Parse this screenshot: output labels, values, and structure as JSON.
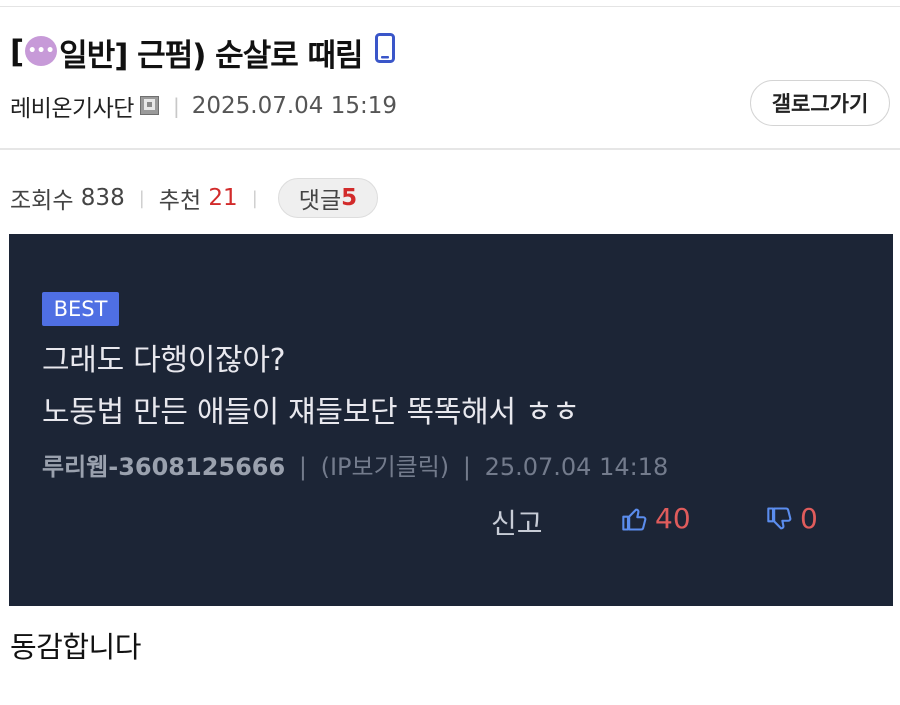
{
  "post": {
    "title_prefix": "[",
    "category": "일반",
    "title_rest": "] 근펌) 순살로 때림",
    "author": "레비온기사단",
    "date": "2025.07.04 15:19",
    "gallery_button": "갤로그가기",
    "stats": {
      "views_label": "조회수",
      "views": "838",
      "recommend_label": "추천",
      "recommend": "21",
      "comments_label": "댓글",
      "comments": "5"
    },
    "body": "동감합니다"
  },
  "embedded_comment": {
    "badge": "BEST",
    "line1": "그래도 다행이잖아?",
    "line2": "노동법 만든 애들이 쟤들보단 똑똑해서 ㅎㅎ",
    "nickname": "루리웹-3608125666",
    "ip": "(IP보기클릭)",
    "date": "25.07.04 14:18",
    "report": "신고",
    "upvotes": "40",
    "downvotes": "0"
  },
  "icons": {
    "category": "speech-bubble-icon",
    "device": "phone-icon",
    "author_badge": "user-icon",
    "thumbs_up": "thumbs-up-icon",
    "thumbs_down": "thumbs-down-icon"
  },
  "colors": {
    "accent_red": "#d22b2b",
    "panel_bg": "#1c2536",
    "best_badge": "#4f6fe3",
    "vote_red": "#e05c5c"
  }
}
